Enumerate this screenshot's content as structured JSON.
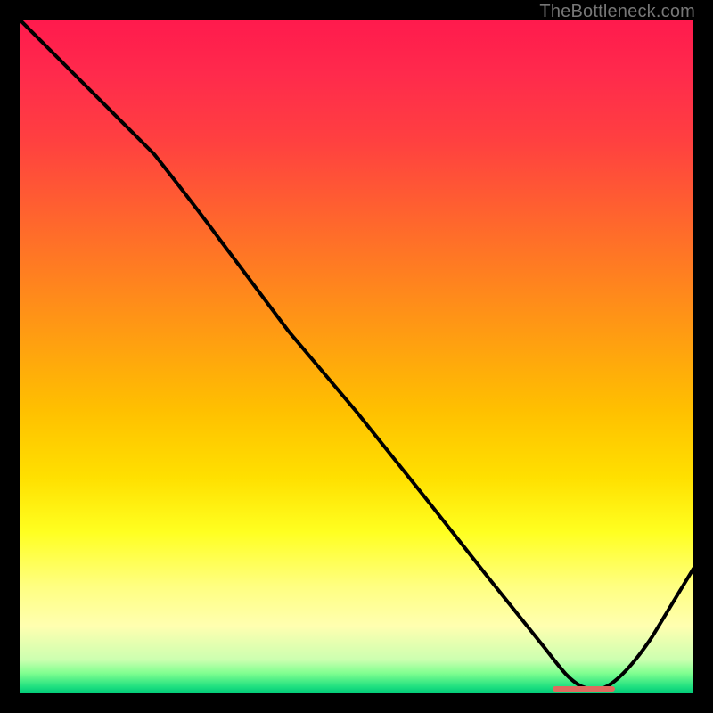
{
  "watermark": "TheBottleneck.com",
  "colors": {
    "background": "#000000",
    "curve_stroke": "#000000",
    "marker_fill": "#e06a5e",
    "gradient_stops": [
      "#ff1a4d",
      "#ff4040",
      "#ff8020",
      "#ffc000",
      "#ffff20",
      "#ffffb0",
      "#80ff90",
      "#00c878"
    ]
  },
  "chart_data": {
    "type": "line",
    "title": "",
    "xlabel": "",
    "ylabel": "",
    "xlim": [
      0,
      100
    ],
    "ylim": [
      0,
      100
    ],
    "x": [
      0,
      8,
      20,
      30,
      40,
      50,
      60,
      70,
      78,
      82,
      86,
      92,
      100
    ],
    "values": [
      100,
      92,
      80,
      67,
      54,
      42,
      29,
      16,
      6,
      2,
      0.5,
      4,
      19
    ],
    "marker_segment": {
      "x_start": 80,
      "x_end": 88,
      "y": 0.5
    },
    "annotations": []
  }
}
